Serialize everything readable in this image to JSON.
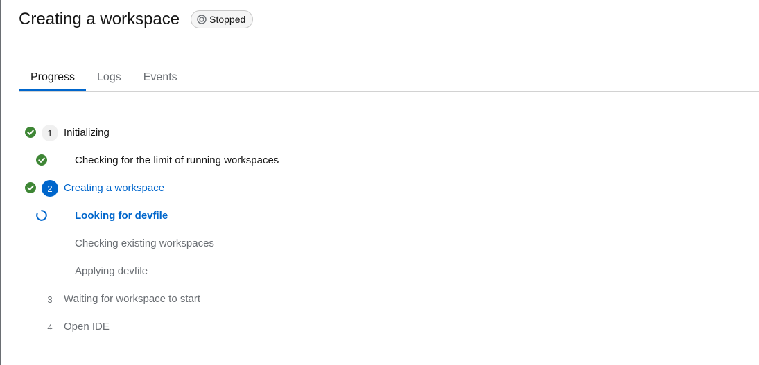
{
  "header": {
    "title": "Creating a workspace",
    "status_badge": {
      "label": "Stopped",
      "icon": "stopped-icon"
    }
  },
  "tabs": [
    {
      "label": "Progress",
      "active": true
    },
    {
      "label": "Logs",
      "active": false
    },
    {
      "label": "Events",
      "active": false
    }
  ],
  "steps": [
    {
      "number": "1",
      "label": "Initializing",
      "state": "done",
      "icon": "check-circle-icon"
    },
    {
      "label": "Checking for the limit of running workspaces",
      "state": "done",
      "icon": "check-circle-icon"
    },
    {
      "number": "2",
      "label": "Creating a workspace",
      "state": "current",
      "icon": "check-circle-icon"
    },
    {
      "label": "Looking for devfile",
      "state": "in-progress",
      "icon": "spinner-icon"
    },
    {
      "label": "Checking existing workspaces",
      "state": "pending"
    },
    {
      "label": "Applying devfile",
      "state": "pending"
    },
    {
      "number": "3",
      "label": "Waiting for workspace to start",
      "state": "pending"
    },
    {
      "number": "4",
      "label": "Open IDE",
      "state": "pending"
    }
  ],
  "colors": {
    "accent": "#0066cc",
    "success": "#3e8635",
    "muted": "#6a6e73"
  }
}
